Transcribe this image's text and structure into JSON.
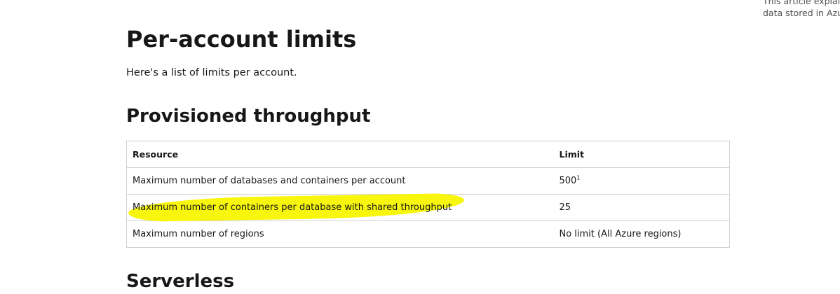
{
  "side_note": {
    "line1": "This article explain",
    "line2": "data stored in Azu"
  },
  "page": {
    "title": "Per-account limits",
    "intro": "Here's a list of limits per account.",
    "section1_heading": "Provisioned throughput",
    "section2_heading": "Serverless"
  },
  "table": {
    "headers": [
      "Resource",
      "Limit"
    ],
    "rows": [
      {
        "resource": "Maximum number of databases and containers per account",
        "limit": "500",
        "footnote": "1"
      },
      {
        "resource": "Maximum number of containers per database with shared throughput",
        "limit": "25",
        "highlighted": true
      },
      {
        "resource": "Maximum number of regions",
        "limit": "No limit (All Azure regions)"
      }
    ]
  },
  "colors": {
    "highlight": "#f7f60c",
    "text": "#171717",
    "border": "#d1d1d1"
  }
}
